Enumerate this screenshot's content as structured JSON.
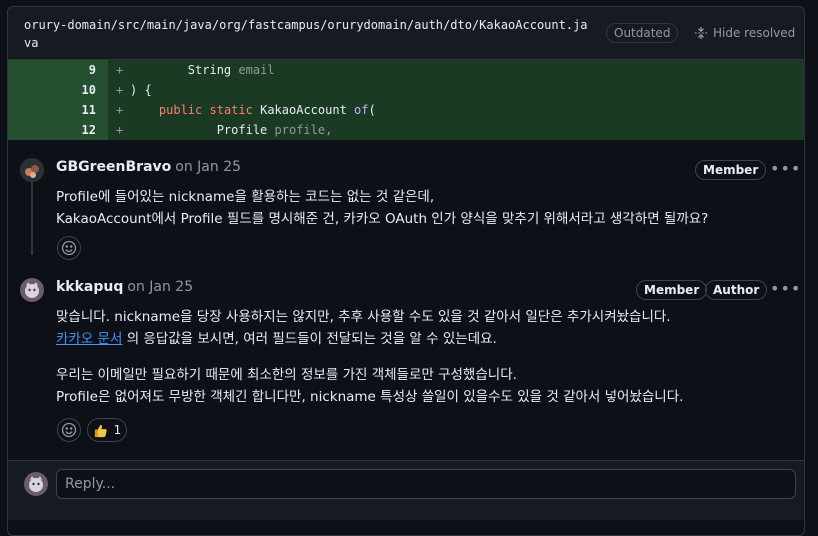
{
  "file": {
    "path": "orury-domain/src/main/java/org/fastcampus/orurydomain/auth/dto/KakaoAccount.java",
    "outdated_label": "Outdated",
    "hide_resolved_label": "Hide resolved"
  },
  "diff": [
    {
      "num": "9",
      "sign": "+"
    },
    {
      "num": "10",
      "sign": "+"
    },
    {
      "num": "11",
      "sign": "+"
    },
    {
      "num": "12",
      "sign": "+"
    }
  ],
  "diff_tokens": {
    "l9_type": "String",
    "l9_name": "email",
    "l10_text": ") {",
    "l11_kw1": "public",
    "l11_kw2": "static",
    "l11_type": "KakaoAccount",
    "l11_fn": "of",
    "l11_paren": "(",
    "l12_type": "Profile",
    "l12_name": "profile,"
  },
  "comments": [
    {
      "author": "GBGreenBravo",
      "date": "on Jan 25",
      "badges": [
        "Member"
      ],
      "lines": [
        "Profile에 들어있는 nickname을 활용하는 코드는 없는 것 같은데,",
        "KakaoAccount에서 Profile 필드를 명시해준 건, 카카오 OAuth 인가 양식을 맞추기 위해서라고 생각하면 될까요?"
      ]
    },
    {
      "author": "kkkapuq",
      "date": "on Jan 25",
      "badges": [
        "Member",
        "Author"
      ],
      "line1": "맞습니다. nickname을 당장 사용하지는 않지만, 추후 사용할 수도 있을 것 같아서 일단은 추가시켜놨습니다.",
      "link": "카카오 문서",
      "line2_rest": " 의 응답값을 보시면, 여러 필드들이 전달되는 것을 알 수 있는데요.",
      "line3": "우리는 이메일만 필요하기 때문에 최소한의 정보를 가진 객체들로만 구성했습니다.",
      "line4": "Profile은 없어져도 무방한 객체긴 합니다만, nickname 특성상 쓸일이 있을수도 있을 것 같아서 넣어놨습니다.",
      "reaction_count": "1"
    }
  ],
  "reply": {
    "placeholder": "Reply..."
  },
  "icons": {
    "emoji": "smiley-icon",
    "thumbs": "thumbs-up-icon",
    "kebab": "kebab-horizontal-icon",
    "hide": "fold-icon"
  },
  "colors": {
    "accent_link": "#4493f8",
    "diff_bg": "#1a3a24"
  }
}
